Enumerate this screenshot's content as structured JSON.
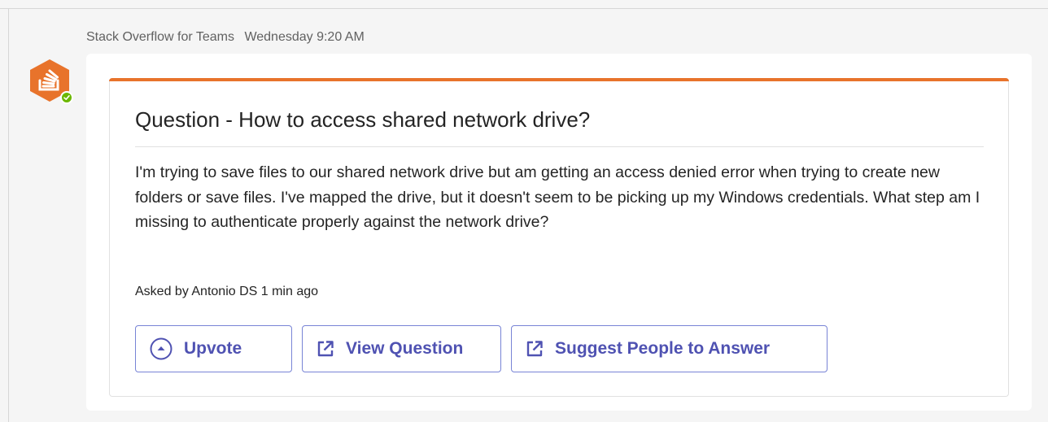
{
  "message": {
    "sender": "Stack Overflow for Teams",
    "timestamp": "Wednesday 9:20 AM",
    "avatar_icon": "stack-overflow-logo-icon",
    "status_icon": "available-check-icon",
    "brand_color": "#e8732b",
    "status_color": "#6bb700"
  },
  "card": {
    "title": "Question - How to access shared network drive?",
    "body": "I'm trying to save files to our shared network drive but am getting an access denied error when trying to create new folders or save files. I've mapped the drive, but it doesn't seem to be picking up my Windows credentials. What step am I missing to authenticate properly against the network drive?",
    "footer": "Asked by Antonio DS 1 min ago",
    "accent_color": "#e8732b",
    "actions": [
      {
        "label": "Upvote",
        "icon": "upvote-circle-icon"
      },
      {
        "label": "View Question",
        "icon": "open-external-icon"
      },
      {
        "label": "Suggest People to Answer",
        "icon": "open-external-icon"
      }
    ],
    "action_color": "#4f52b2"
  }
}
